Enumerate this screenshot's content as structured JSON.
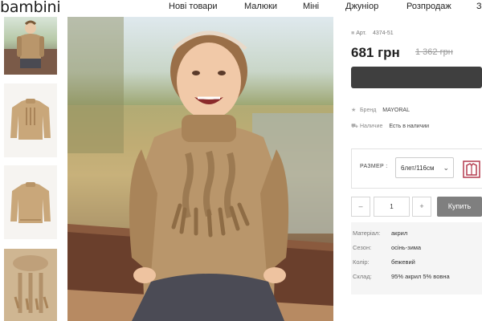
{
  "header": {
    "logo": "bambini",
    "nav": [
      "Нові товари",
      "Малюки",
      "Міні",
      "Джуніор",
      "Розпродаж",
      "З"
    ]
  },
  "gallery": {
    "thumbnails": [
      "thumbnail-photo",
      "thumbnail-front",
      "thumbnail-back",
      "thumbnail-detail"
    ]
  },
  "product": {
    "article_label": "Арт.",
    "article": "4374-51",
    "price": "681 грн",
    "old_price": "1 362 грн",
    "brand_label": "Бренд",
    "brand": "MAYORAL",
    "availability_label": "Наличие",
    "availability": "Есть в наличии",
    "size_label": "РАЗМЕР :",
    "size_value": "6лет/116см",
    "quantity": "1",
    "buy_label": "Купить",
    "attributes": [
      {
        "key": "Матеріал:",
        "value": "акрил"
      },
      {
        "key": "Сезон:",
        "value": "осінь-зима"
      },
      {
        "key": "Колір:",
        "value": "бежевий"
      },
      {
        "key": "Склад:",
        "value": "95% акрил 5% вовна"
      }
    ]
  },
  "icons": {
    "star": "★",
    "availability": "⛟",
    "minus": "–",
    "plus": "+",
    "chevron": "⌄"
  },
  "colors": {
    "sweater": "#b9966b",
    "sweater_dark": "#9c7a52",
    "button_dark": "#3f3f3f",
    "button_buy": "#7f7f7f",
    "size_icon": "#b43a4e"
  }
}
